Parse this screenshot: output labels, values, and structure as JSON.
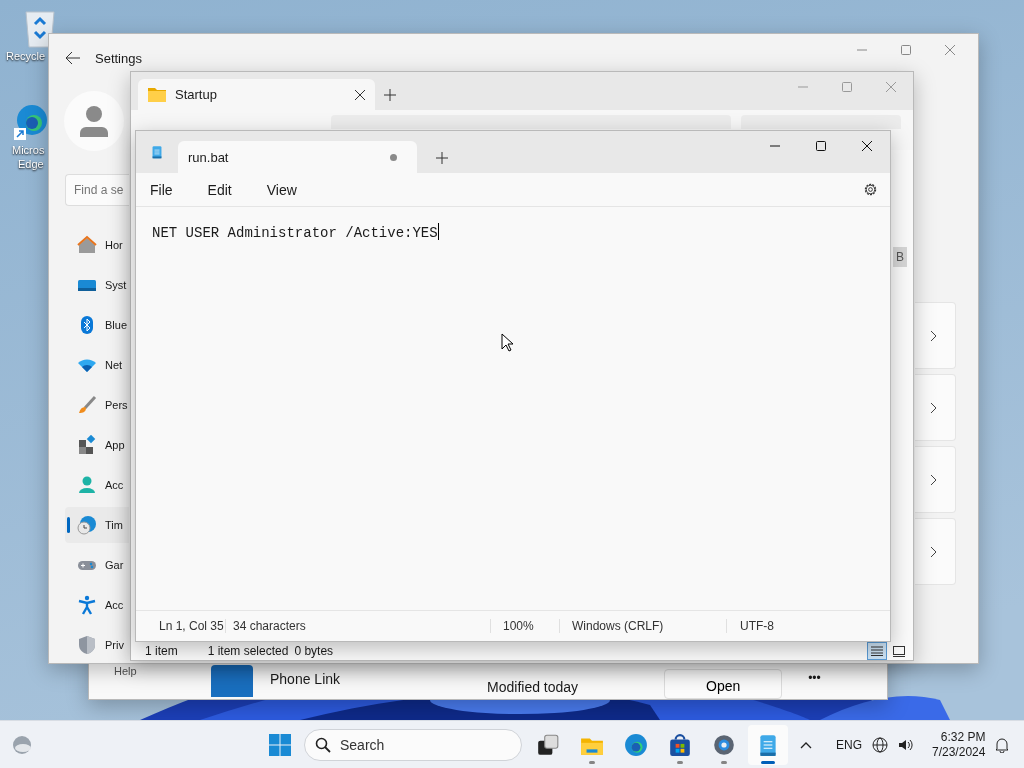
{
  "desktop": {
    "icons": [
      {
        "kind": "recycle-bin",
        "label_lines": [
          "Recycle"
        ]
      },
      {
        "kind": "edge",
        "label_lines": [
          "Micros",
          "Edge"
        ]
      }
    ]
  },
  "back_window": {
    "nav_item": "Help",
    "row": {
      "name": "Phone Link",
      "modified": "Modified today",
      "action": "Open",
      "more": "•••"
    }
  },
  "settings": {
    "title": "Settings",
    "search": {
      "placeholder": "Find a se"
    },
    "nav": [
      {
        "kind": "home",
        "label": "Hor",
        "selected": false
      },
      {
        "kind": "system",
        "label": "Syst",
        "selected": false
      },
      {
        "kind": "bluetooth",
        "label": "Blue",
        "selected": false
      },
      {
        "kind": "network",
        "label": "Net",
        "selected": false
      },
      {
        "kind": "personalization",
        "label": "Pers",
        "selected": false
      },
      {
        "kind": "apps",
        "label": "App",
        "selected": false
      },
      {
        "kind": "accounts",
        "label": "Acc",
        "selected": false
      },
      {
        "kind": "time",
        "label": "Tim",
        "selected": true
      },
      {
        "kind": "gaming",
        "label": "Gar",
        "selected": false
      },
      {
        "kind": "accessibility",
        "label": "Acc",
        "selected": false
      },
      {
        "kind": "privacy",
        "label": "Priv",
        "selected": false
      }
    ]
  },
  "explorer": {
    "tab": "Startup",
    "chip": "B",
    "status": [
      "1 item",
      "1 item selected",
      "0 bytes"
    ],
    "views": [
      {
        "kind": "details",
        "selected": true
      },
      {
        "kind": "tiles",
        "selected": false
      }
    ]
  },
  "notepad": {
    "tab": {
      "title": "run.bat",
      "unsaved": true
    },
    "menu": [
      "File",
      "Edit",
      "View"
    ],
    "text": "NET USER Administrator /Active:YES",
    "status": [
      "Ln 1, Col 35",
      "34 characters",
      "100%",
      "Windows (CRLF)",
      "UTF-8"
    ]
  },
  "taskbar": {
    "search": {
      "placeholder": "Search"
    },
    "apps": [
      {
        "kind": "task-view",
        "running": false,
        "active": false
      },
      {
        "kind": "explorer",
        "running": true,
        "active": false
      },
      {
        "kind": "edge",
        "running": false,
        "active": false
      },
      {
        "kind": "store",
        "running": true,
        "active": false
      },
      {
        "kind": "settings",
        "running": true,
        "active": false
      },
      {
        "kind": "notepad",
        "running": true,
        "active": true
      }
    ],
    "tray": {
      "language": "ENG",
      "time": "6:32 PM",
      "date": "7/23/2024"
    }
  }
}
